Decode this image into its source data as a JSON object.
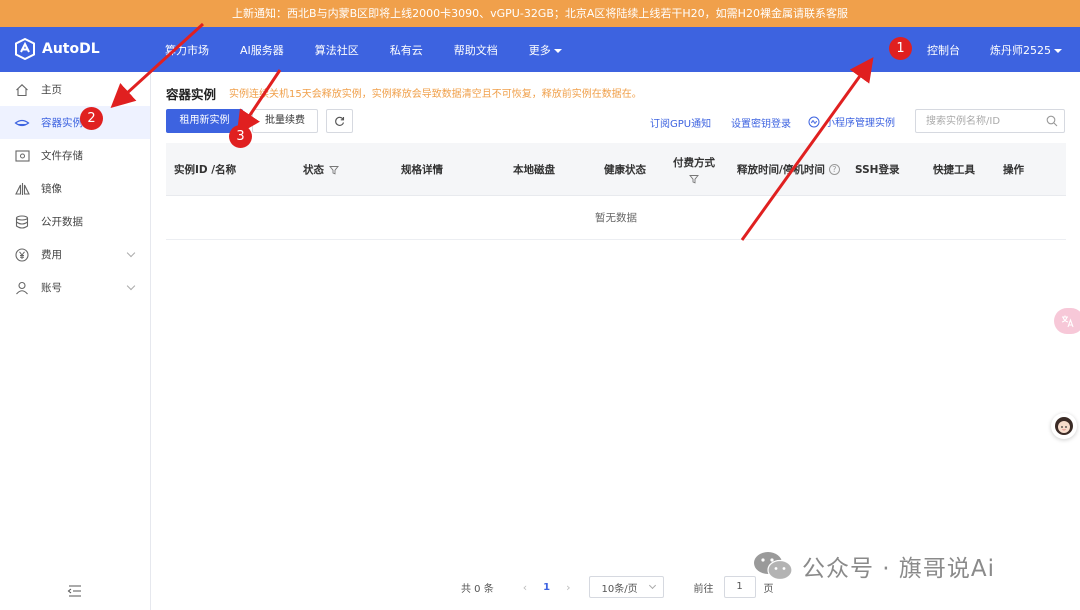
{
  "notice": {
    "text": "上新通知：西北B与内蒙B区即将上线2000卡3090、vGPU-32GB；北京A区将陆续上线若干H20，如需H20裸金属请联系客服"
  },
  "topnav": {
    "logo_text": "AutoDL",
    "items": [
      {
        "label": "算力市场"
      },
      {
        "label": "AI服务器"
      },
      {
        "label": "算法社区"
      },
      {
        "label": "私有云"
      },
      {
        "label": "帮助文档"
      },
      {
        "label": "更多"
      }
    ],
    "console_label": "控制台",
    "user_label": "炼丹师2525"
  },
  "sidebar": {
    "items": [
      {
        "label": "主页",
        "icon": "home-icon"
      },
      {
        "label": "容器实例",
        "icon": "container-icon"
      },
      {
        "label": "文件存储",
        "icon": "storage-icon"
      },
      {
        "label": "镜像",
        "icon": "image-icon"
      },
      {
        "label": "公开数据",
        "icon": "database-icon"
      },
      {
        "label": "费用",
        "icon": "yen-icon"
      },
      {
        "label": "账号",
        "icon": "user-icon"
      }
    ]
  },
  "main": {
    "title": "容器实例",
    "warning": "实例连续关机15天会释放实例，实例释放会导致数据清空且不可恢复，释放前实例在数据在。",
    "toolbar": {
      "rent_label": "租用新实例",
      "renew_label": "批量续费",
      "subscribe_label": "订阅GPU通知",
      "ssh_key_label": "设置密钥登录",
      "miniprogram_label": "小程序管理实例",
      "search_placeholder": "搜索实例名称/ID"
    },
    "table": {
      "columns": [
        "实例ID /名称",
        "状态",
        "规格详情",
        "本地磁盘",
        "健康状态",
        "付费方式",
        "释放时间/停机时间",
        "SSH登录",
        "快捷工具",
        "操作"
      ],
      "empty_text": "暂无数据"
    },
    "pager": {
      "total": "共 0 条",
      "current_page": "1",
      "page_size": "10条/页",
      "goto_label": "前往",
      "goto_value": "1",
      "page_unit": "页"
    }
  },
  "watermark": {
    "text": "公众号 · 旗哥说Ai"
  },
  "annotations": {
    "badges": [
      "1",
      "2",
      "3"
    ],
    "color": "#e02020"
  }
}
